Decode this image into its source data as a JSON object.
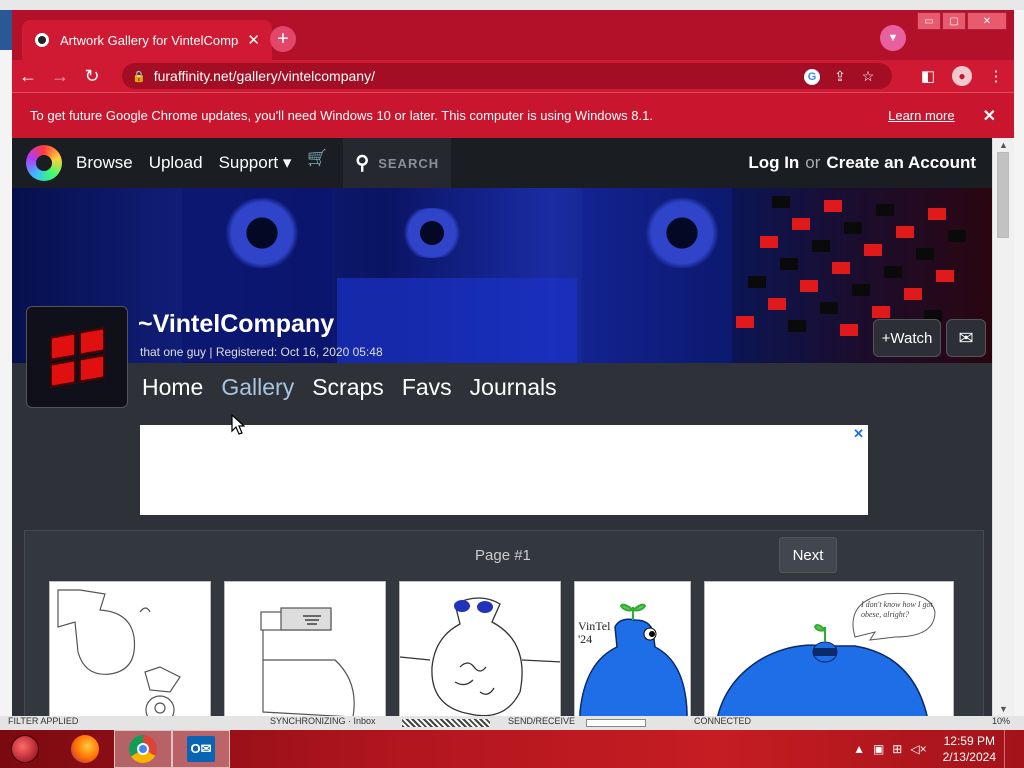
{
  "browser": {
    "tab_title": "Artwork Gallery for VintelCompany",
    "tab_close": "✕",
    "new_tab": "+",
    "url": "furaffinity.net/gallery/vintelcompany/",
    "win_min": "▭",
    "win_max": "▢",
    "win_close": "✕"
  },
  "infobar": {
    "message": "To get future Google Chrome updates, you'll need Windows 10 or later. This computer is using Windows 8.1.",
    "learn_more": "Learn more",
    "close": "✕"
  },
  "site_nav": {
    "browse": "Browse",
    "upload": "Upload",
    "support": "Support ▾",
    "search_placeholder": "SEARCH",
    "login": "Log In",
    "or": "or",
    "create_account": "Create an Account"
  },
  "profile": {
    "username": "~VintelCompany",
    "status": "that one guy | Registered: Oct 16, 2020 05:48",
    "watch": "+Watch"
  },
  "user_tabs": [
    "Home",
    "Gallery",
    "Scraps",
    "Favs",
    "Journals"
  ],
  "active_tab": "Gallery",
  "ad": {
    "close": "✕"
  },
  "gallery": {
    "page_label": "Page #1",
    "next": "Next",
    "thumb3_text": "VinTel '24",
    "thumb5_text": "I don't know how I got obese, alright?"
  },
  "outlook_status": {
    "filter": "FILTER APPLIED",
    "sync": "SYNCHRONIZING · Inbox",
    "send": "SEND/RECEIVE",
    "connected": "CONNECTED",
    "zoom": "10%"
  },
  "taskbar": {
    "time": "12:59 PM",
    "date": "2/13/2024"
  },
  "colors": {
    "browser_frame": "#c9152d",
    "site_nav_bg": "#1a1d22",
    "active_tab_text": "#a8c4e0"
  }
}
